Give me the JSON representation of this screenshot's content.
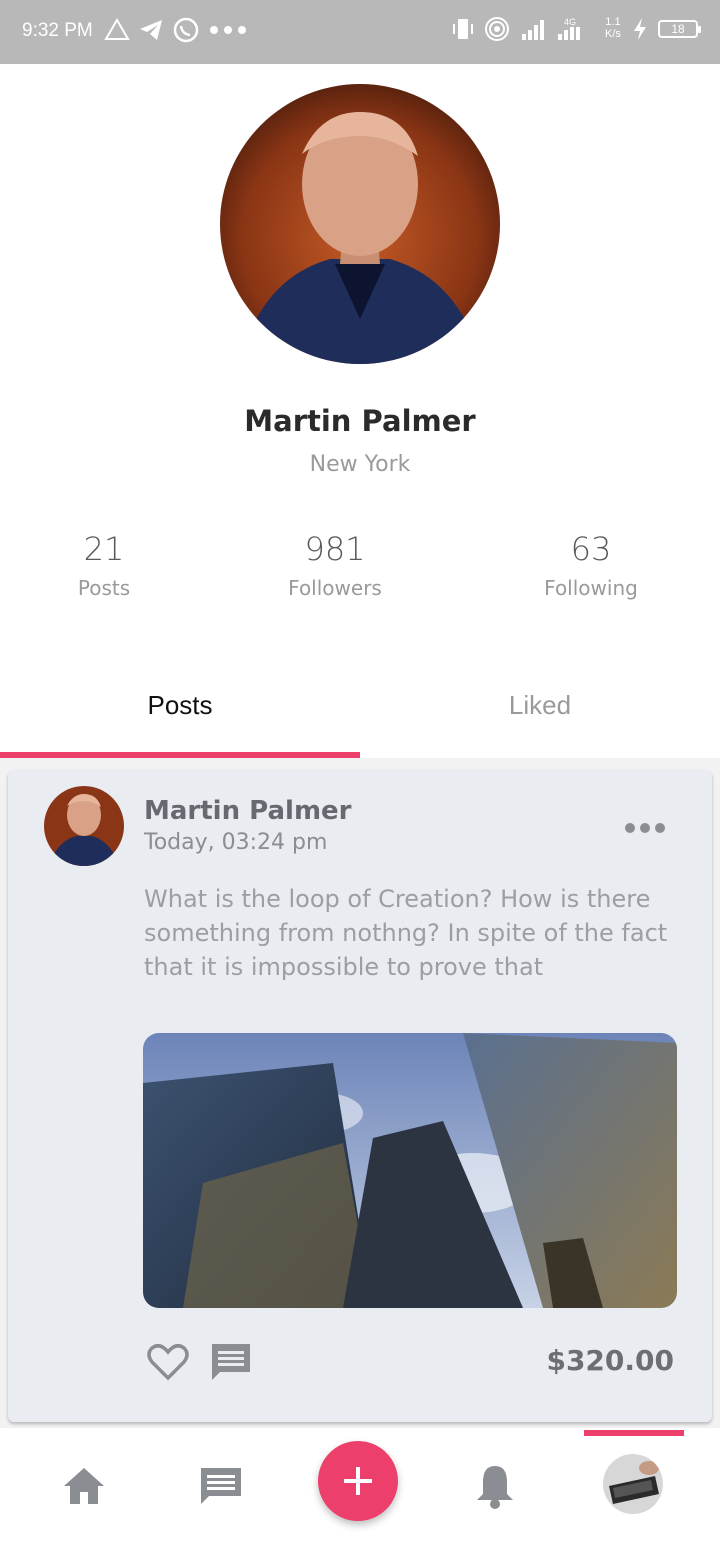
{
  "status_bar": {
    "time": "9:32 PM",
    "network_speed": "1.1",
    "network_unit": "K/s",
    "network_type": "4G",
    "battery": "18"
  },
  "profile": {
    "name": "Martin Palmer",
    "location": "New York",
    "stats": [
      {
        "value": "21",
        "label": "Posts"
      },
      {
        "value": "981",
        "label": "Followers"
      },
      {
        "value": "63",
        "label": "Following"
      }
    ]
  },
  "tabs": {
    "posts": "Posts",
    "liked": "Liked",
    "active": "Posts"
  },
  "post": {
    "author": "Martin Palmer",
    "time": "Today, 03:24 pm",
    "text": "What is the loop of Creation? How is there something from nothng? In spite of the fact that it is impossible to prove that",
    "price": "$320.00"
  },
  "bottom_nav": {
    "items": [
      "home-icon",
      "chat-icon",
      "add-icon",
      "bell-icon",
      "profile-avatar"
    ],
    "active": "profile-avatar"
  },
  "colors": {
    "accent": "#ec3f6b",
    "status_bar": "#b8b8b8",
    "card_bg": "#e9ecf0"
  }
}
